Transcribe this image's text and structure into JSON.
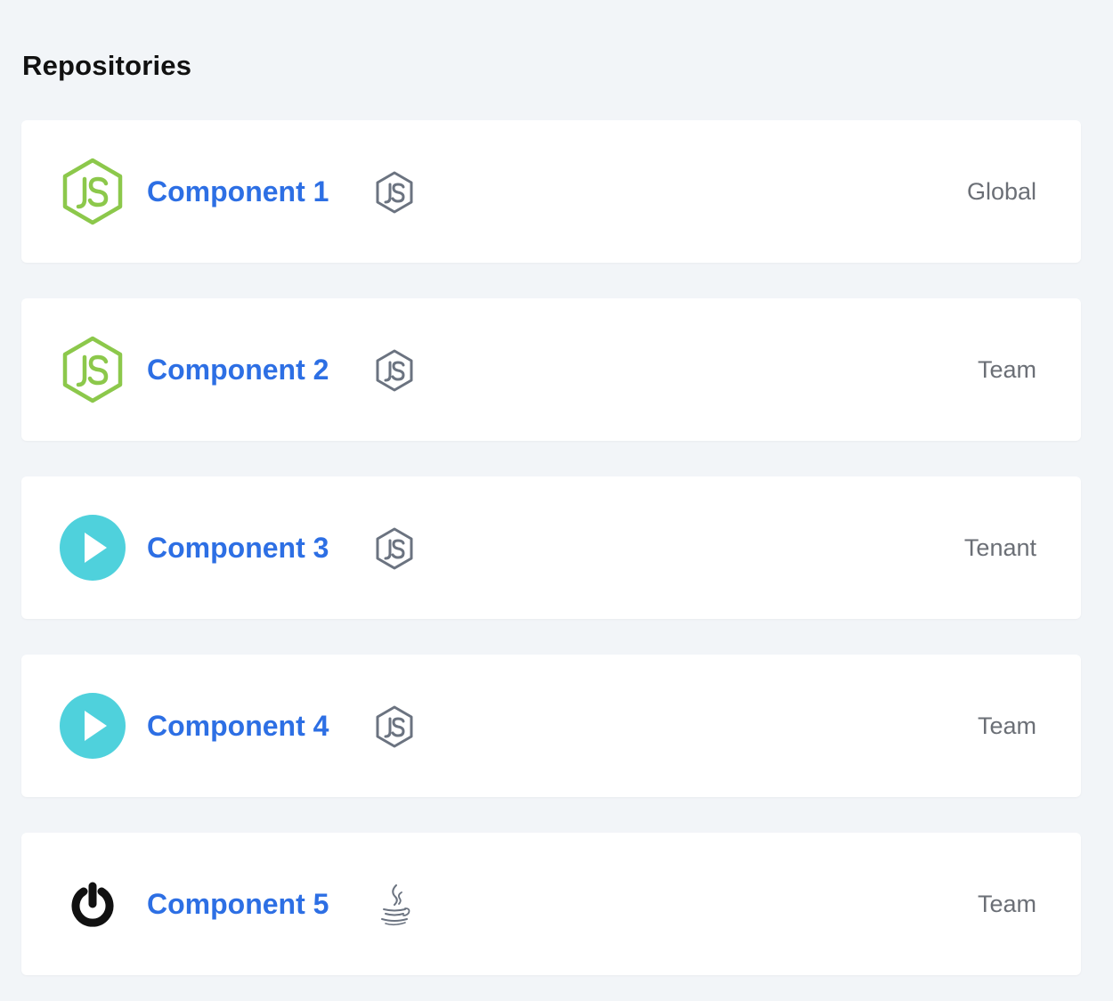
{
  "page": {
    "title": "Repositories"
  },
  "colors": {
    "background": "#f2f5f8",
    "card": "#ffffff",
    "link": "#2d6fe4",
    "scope_text": "#6b6f76",
    "node_green": "#8cc84b",
    "play_cyan": "#4fd1dc",
    "lang_gray": "#6b7380"
  },
  "repositories": [
    {
      "name": "Component 1",
      "avatar_icon": "nodejs-logo-icon",
      "language_icon": "nodejs-icon",
      "scope": "Global"
    },
    {
      "name": "Component 2",
      "avatar_icon": "nodejs-logo-icon",
      "language_icon": "nodejs-icon",
      "scope": "Team"
    },
    {
      "name": "Component 3",
      "avatar_icon": "play-circle-icon",
      "language_icon": "nodejs-icon",
      "scope": "Tenant"
    },
    {
      "name": "Component 4",
      "avatar_icon": "play-circle-icon",
      "language_icon": "nodejs-icon",
      "scope": "Team"
    },
    {
      "name": "Component 5",
      "avatar_icon": "power-icon",
      "language_icon": "java-icon",
      "scope": "Team"
    }
  ]
}
